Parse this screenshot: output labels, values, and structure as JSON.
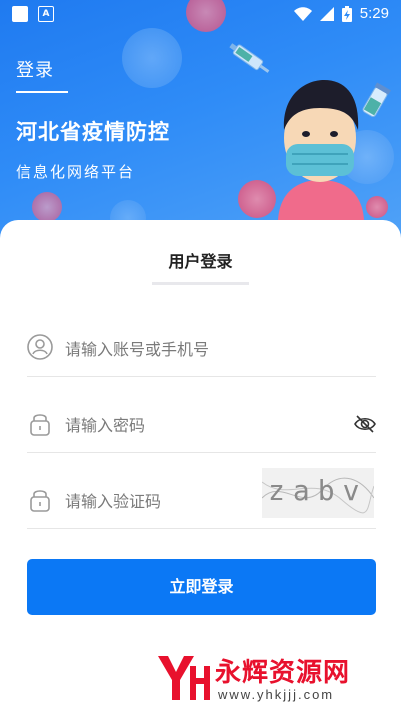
{
  "status_bar": {
    "time": "5:29",
    "icons": [
      "square-notification-icon",
      "a-notification-icon",
      "wifi-icon",
      "signal-icon",
      "battery-charging-icon"
    ]
  },
  "header": {
    "page_title": "登录",
    "app_title": "河北省疫情防控",
    "app_subtitle": "信息化网络平台",
    "background_color": "#2f8cf7"
  },
  "login_card": {
    "tab_label": "用户登录",
    "account_placeholder": "请输入账号或手机号",
    "password_placeholder": "请输入密码",
    "captcha_placeholder": "请输入验证码",
    "captcha_text": "zabv",
    "submit_label": "立即登录",
    "accent_color": "#0b78f5"
  },
  "watermark": {
    "logo_text": "YH",
    "site_name": "永辉资源网",
    "url": "www.yhkjjj.com"
  }
}
